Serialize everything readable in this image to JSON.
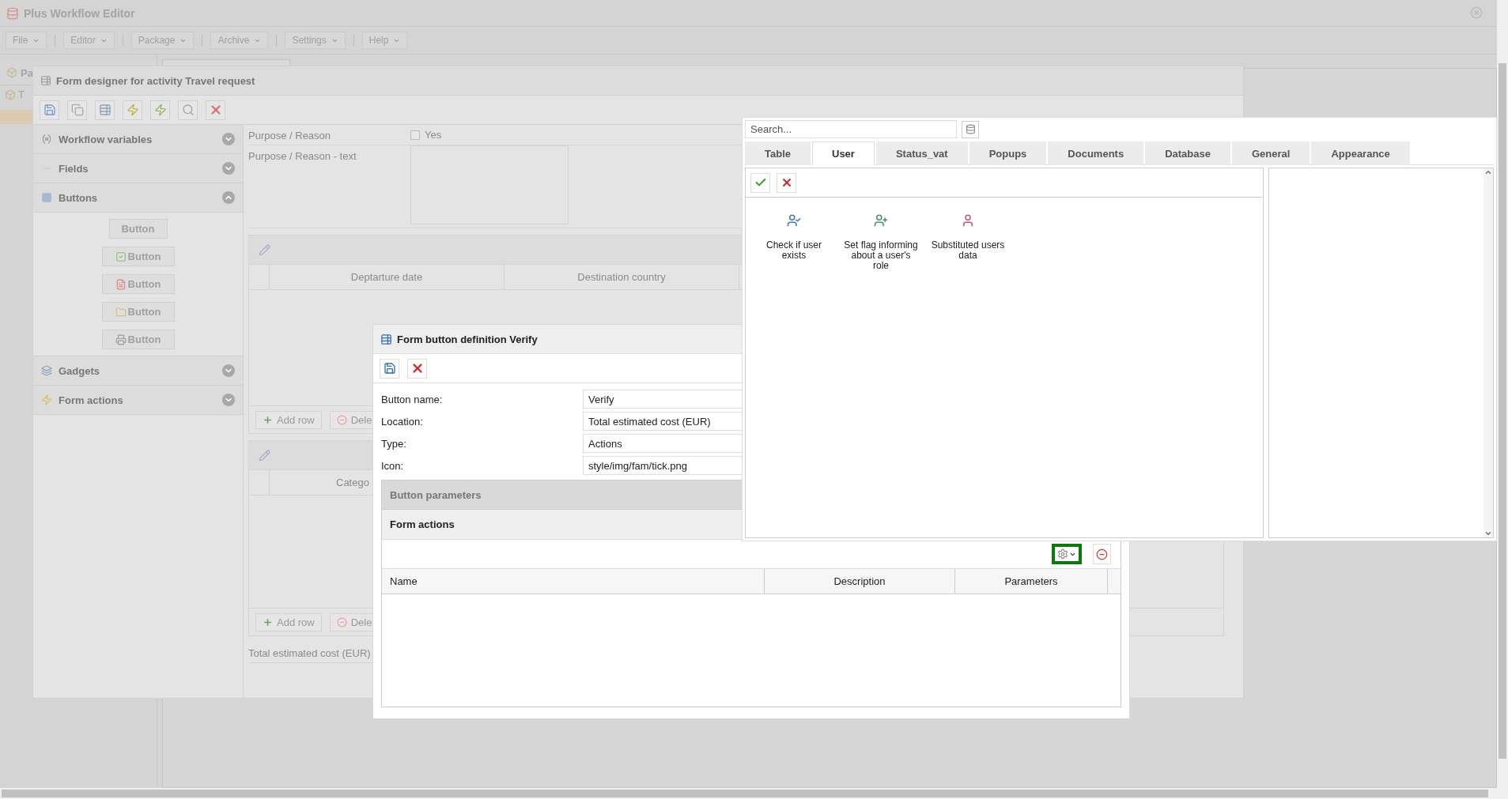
{
  "app": {
    "title": "Plus Workflow Editor",
    "menu": [
      "File",
      "Editor",
      "Package",
      "Archive",
      "Settings",
      "Help"
    ],
    "sidebar_header": "Pa",
    "tree_item": "T"
  },
  "form_designer": {
    "title": "Form designer for activity Travel request",
    "toolbar": [
      {
        "kind": "save"
      },
      {
        "kind": "copy"
      },
      {
        "kind": "add-table"
      },
      {
        "kind": "add-action"
      },
      {
        "kind": "run-action"
      },
      {
        "kind": "preview"
      },
      {
        "kind": "delete"
      }
    ],
    "sections": [
      {
        "title": "Workflow variables",
        "kind": "variables",
        "expanded": false
      },
      {
        "title": "Fields",
        "kind": "fields",
        "expanded": false
      },
      {
        "title": "Buttons",
        "kind": "buttons",
        "expanded": true,
        "items": [
          {
            "label": "Button",
            "kind": "plain"
          },
          {
            "label": "Button",
            "kind": "tick"
          },
          {
            "label": "Button",
            "kind": "pdf"
          },
          {
            "label": "Button",
            "kind": "folder"
          },
          {
            "label": "Button",
            "kind": "print"
          }
        ]
      },
      {
        "title": "Gadgets",
        "kind": "gadgets",
        "expanded": false
      },
      {
        "title": "Form actions",
        "kind": "actions",
        "expanded": false
      }
    ],
    "form": {
      "fields": [
        {
          "label": "Purpose / Reason",
          "kind": "checkbox",
          "value": "Yes",
          "checked": false
        },
        {
          "label": "Purpose / Reason - text",
          "kind": "textarea"
        }
      ],
      "tables": [
        {
          "columns": [
            "Deptarture date",
            "Destination country"
          ],
          "buttons": [
            "Add row",
            "Dele"
          ]
        },
        {
          "columns": [
            "Catego"
          ],
          "buttons": [
            "Add row",
            "Dele"
          ]
        }
      ],
      "total_label": "Total estimated cost (EUR)"
    }
  },
  "button_dialog": {
    "title": "Form button definition Verify",
    "toolbar": [
      {
        "kind": "save"
      },
      {
        "kind": "cancel"
      }
    ],
    "fields": [
      {
        "label": "Button name:",
        "value": "Verify"
      },
      {
        "label": "Location:",
        "value": "Total estimated cost (EUR)"
      },
      {
        "label": "Type:",
        "value": "Actions"
      },
      {
        "label": "Icon:",
        "value": "style/img/fam/tick.png"
      }
    ],
    "parameters_header": "Button parameters",
    "actions_header": "Form actions",
    "actions_toolbar": [
      {
        "kind": "gear-menu",
        "highlighted": true
      },
      {
        "kind": "remove",
        "highlighted": false
      }
    ],
    "columns": [
      "Name",
      "Description",
      "Parameters"
    ]
  },
  "action_picker": {
    "search": {
      "placeholder": "Search..."
    },
    "tabs": [
      {
        "label": "Table",
        "selected": false
      },
      {
        "label": "User",
        "selected": true
      },
      {
        "label": "Status_vat",
        "selected": false
      },
      {
        "label": "Popups",
        "selected": false
      },
      {
        "label": "Documents",
        "selected": false
      },
      {
        "label": "Database",
        "selected": false
      },
      {
        "label": "General",
        "selected": false
      },
      {
        "label": "Appearance",
        "selected": false
      }
    ],
    "toolbar": [
      {
        "kind": "accept"
      },
      {
        "kind": "cancel"
      }
    ],
    "items": [
      {
        "label": "Check if user exists",
        "kind": "user-check"
      },
      {
        "label": "Set flag informing about a user's role",
        "kind": "user-flag"
      },
      {
        "label": "Substituted users data",
        "kind": "user-female"
      }
    ]
  }
}
